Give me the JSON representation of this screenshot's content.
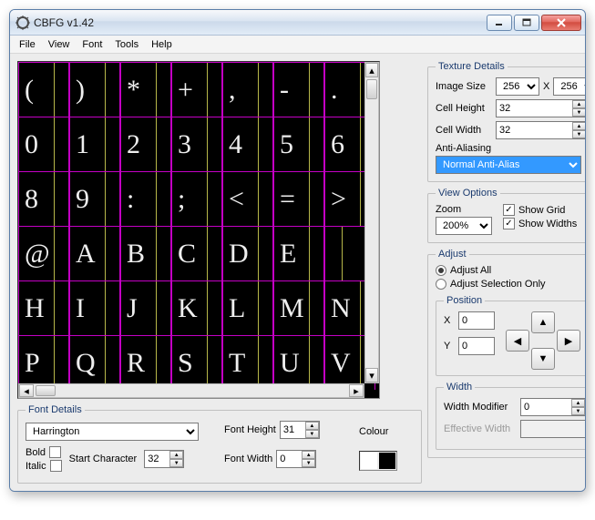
{
  "window": {
    "title": "CBFG v1.42"
  },
  "menubar": [
    "File",
    "View",
    "Font",
    "Tools",
    "Help"
  ],
  "preview": {
    "glyphs": [
      "(",
      ")",
      "*",
      "+",
      ",",
      "-",
      ".",
      "0",
      "1",
      "2",
      "3",
      "4",
      "5",
      "6",
      "8",
      "9",
      ":",
      ";",
      "<",
      "=",
      ">",
      "@",
      "A",
      "B",
      "C",
      "D",
      "E",
      " ",
      "H",
      "I",
      "J",
      "K",
      "L",
      "M",
      "N",
      "P",
      "Q",
      "R",
      "S",
      "T",
      "U",
      "V"
    ],
    "vscroll_thumb_pos": 0.05,
    "hscroll_thumb_pos": 0.0
  },
  "font_details": {
    "legend": "Font Details",
    "font_name": "Harrington",
    "bold_label": "Bold",
    "bold": false,
    "italic_label": "Italic",
    "italic": false,
    "start_char_label": "Start Character",
    "start_char": "32",
    "font_height_label": "Font Height",
    "font_height": "31",
    "font_width_label": "Font Width",
    "font_width": "0",
    "colour_label": "Colour",
    "fg": "#ffffff",
    "bg": "#000000"
  },
  "texture": {
    "legend": "Texture Details",
    "image_size_label": "Image Size",
    "image_w": "256",
    "x_label": "X",
    "image_h": "256",
    "cell_h_label": "Cell Height",
    "cell_h": "32",
    "cell_w_label": "Cell Width",
    "cell_w": "32",
    "aa_label": "Anti-Aliasing",
    "aa_value": "Normal Anti-Alias"
  },
  "view": {
    "legend": "View Options",
    "zoom_label": "Zoom",
    "zoom": "200%",
    "show_grid_label": "Show Grid",
    "show_grid": true,
    "show_widths_label": "Show Widths",
    "show_widths": true
  },
  "adjust": {
    "legend": "Adjust",
    "all_label": "Adjust All",
    "all": true,
    "sel_label": "Adjust Selection Only",
    "sel": false,
    "position_legend": "Position",
    "x_label": "X",
    "x": "0",
    "y_label": "Y",
    "y": "0",
    "width_legend": "Width",
    "width_mod_label": "Width Modifier",
    "width_mod": "0",
    "eff_width_label": "Effective Width",
    "eff_width": ""
  }
}
